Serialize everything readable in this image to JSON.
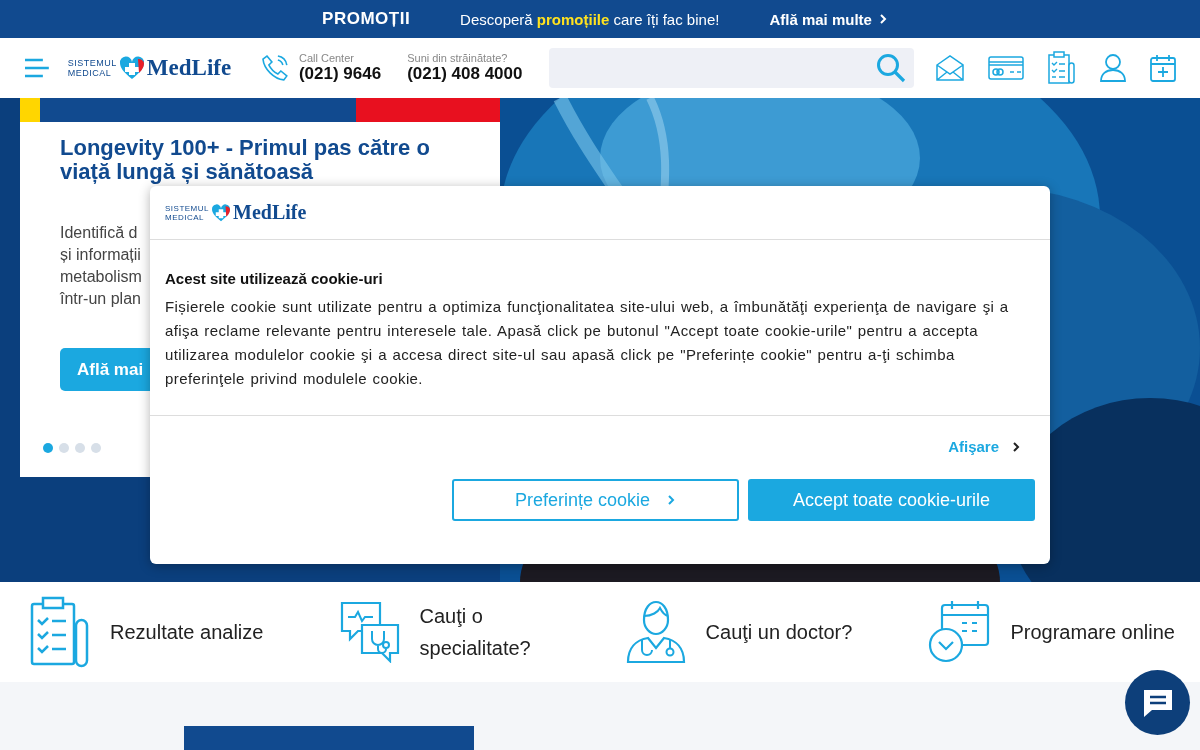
{
  "promo_bar": {
    "title": "PROMOȚII",
    "text_before": "Descoperă",
    "highlight": "promoțiile",
    "text_after": "care îți fac bine!",
    "link": "Află mai multe"
  },
  "header": {
    "logo": {
      "line_1": "SISTEMUL",
      "line_2": "MEDICAL",
      "name": "MedLife"
    },
    "contacts": [
      {
        "label": "Call Center",
        "number": "(021) 9646"
      },
      {
        "label": "Suni din străinătate?",
        "number": "(021) 408 4000"
      }
    ]
  },
  "hero": {
    "title_lines": [
      "Longevity 100+ - Primul pas către o",
      "viață lungă și sănătoasă"
    ],
    "description_lines": [
      "Identifică d",
      "și informații",
      "metabolism",
      "într-un plan"
    ],
    "button": "Află mai",
    "slides": [
      {
        "selected": true
      },
      {
        "selected": false
      },
      {
        "selected": false
      },
      {
        "selected": false
      }
    ]
  },
  "cookie_dialog": {
    "logo": {
      "line_1": "SISTEMUL",
      "line_2": "MEDICAL",
      "name": "MedLife"
    },
    "heading": "Acest site utilizează cookie-uri",
    "body": "Fișierele cookie sunt utilizate pentru a optimiza funcţionalitatea site-ului web, a îmbunătăţi experienţa de navigare şi a afişa reclame relevante pentru interesele tale. Apasă click pe butonul \"Accept toate cookie-urile\" pentru a accepta utilizarea modulelor cookie şi a accesa direct site-ul sau apasă click pe \"Preferințe cookie\" pentru a-ţi schimba preferinţele privind modulele cookie.",
    "link": "Afişare",
    "buttons": [
      {
        "label": "Preferințe cookie",
        "kind": "outline"
      },
      {
        "label": "Accept toate cookie-urile",
        "kind": "primary"
      }
    ]
  },
  "shortcuts": [
    {
      "label": "Rezultate analize",
      "kind": "results"
    },
    {
      "label": "Cauţi o specialitate?",
      "kind": "specialty"
    },
    {
      "label": "Cauţi un doctor?",
      "kind": "doctor"
    },
    {
      "label": "Programare online",
      "kind": "booking"
    }
  ]
}
